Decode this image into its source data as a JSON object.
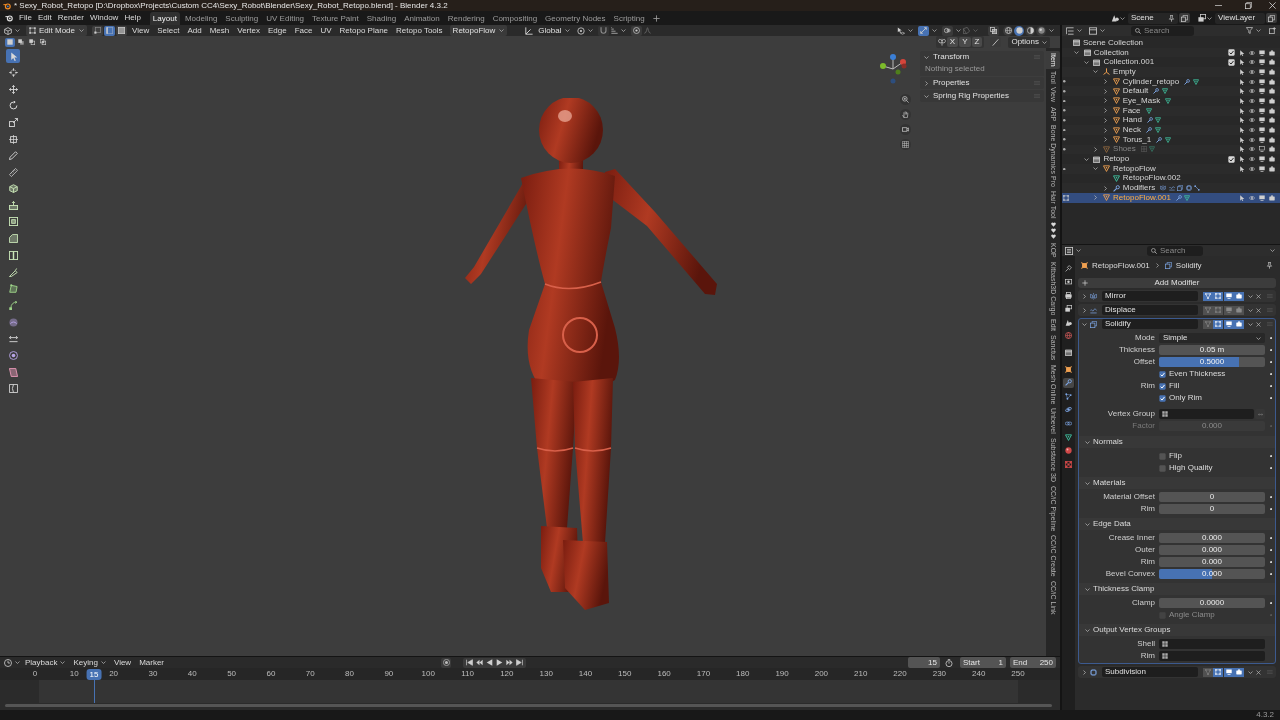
{
  "window": {
    "title": "* Sexy_Robot_Retopo [D:\\Dropbox\\Projects\\Custom CC4\\Sexy_Robot\\Blender\\Sexy_Robot_Retopo.blend] - Blender 4.3.2"
  },
  "menu": [
    "File",
    "Edit",
    "Render",
    "Window",
    "Help"
  ],
  "workspaces": [
    {
      "label": "Layout",
      "selected": true
    },
    {
      "label": "Modeling",
      "selected": false
    },
    {
      "label": "Sculpting",
      "selected": false
    },
    {
      "label": "UV Editing",
      "selected": false
    },
    {
      "label": "Texture Paint",
      "selected": false
    },
    {
      "label": "Shading",
      "selected": false
    },
    {
      "label": "Animation",
      "selected": false
    },
    {
      "label": "Rendering",
      "selected": false
    },
    {
      "label": "Compositing",
      "selected": false
    },
    {
      "label": "Geometry Nodes",
      "selected": false
    },
    {
      "label": "Scripting",
      "selected": false
    }
  ],
  "scene": {
    "name": "Scene",
    "view_layer": "ViewLayer"
  },
  "viewport": {
    "mode": "Edit Mode",
    "select_modes": [
      {
        "kind": "vertex",
        "selected": false
      },
      {
        "kind": "edge",
        "selected": true
      },
      {
        "kind": "face",
        "selected": false
      }
    ],
    "menus": [
      "View",
      "Select",
      "Add",
      "Mesh",
      "Vertex",
      "Edge",
      "Face",
      "UV",
      "Retopo Plane",
      "Retopo Tools"
    ],
    "addon_menu": "RetopoFlow",
    "orientation": "Global",
    "gizmos": true,
    "overlays": false,
    "xray": false,
    "shading": [
      {
        "kind": "wireframe",
        "selected": false
      },
      {
        "kind": "solid",
        "selected": true
      },
      {
        "kind": "material",
        "selected": false
      },
      {
        "kind": "rendered",
        "selected": false
      }
    ],
    "box_modes": [
      {
        "kind": "set",
        "selected": true
      },
      {
        "kind": "extend",
        "selected": false
      },
      {
        "kind": "subtract",
        "selected": false
      },
      {
        "kind": "intersect",
        "selected": false
      }
    ],
    "mirror_axes": [
      {
        "label": "X",
        "selected": false
      },
      {
        "label": "Y",
        "selected": false
      },
      {
        "label": "Z",
        "selected": false
      }
    ],
    "options": "Options",
    "tool_groups": [
      {
        "tools": [
          {
            "kind": "select",
            "selected": true
          }
        ]
      },
      {
        "tools": [
          {
            "kind": "cursor",
            "selected": false
          }
        ]
      },
      {
        "tools": [
          {
            "kind": "move",
            "selected": false
          },
          {
            "kind": "rotate",
            "selected": false
          },
          {
            "kind": "scale",
            "selected": false
          },
          {
            "kind": "transform",
            "selected": false
          }
        ]
      },
      {
        "tools": [
          {
            "kind": "annotate",
            "selected": false
          },
          {
            "kind": "measure",
            "selected": false
          }
        ]
      },
      {
        "tools": [
          {
            "kind": "add_cube",
            "selected": false
          }
        ]
      },
      {
        "tools": [
          {
            "kind": "extrude",
            "selected": false
          },
          {
            "kind": "inset",
            "selected": false
          },
          {
            "kind": "bevel",
            "selected": false
          },
          {
            "kind": "loop_cut",
            "selected": false
          },
          {
            "kind": "knife",
            "selected": false
          },
          {
            "kind": "poly_build",
            "selected": false
          },
          {
            "kind": "spin",
            "selected": false
          },
          {
            "kind": "smooth",
            "selected": false
          },
          {
            "kind": "edge_slide",
            "selected": false
          },
          {
            "kind": "shrink",
            "selected": false
          },
          {
            "kind": "shear",
            "selected": false
          },
          {
            "kind": "rip",
            "selected": false
          }
        ]
      }
    ],
    "sidebar": {
      "panels": [
        {
          "title": "Transform",
          "expanded": true,
          "text": "Nothing selected"
        },
        {
          "title": "Properties",
          "expanded": false
        },
        {
          "title": "Spring Rig Properties",
          "expanded": true
        }
      ],
      "tabs": [
        {
          "kind": "text",
          "label": "Item",
          "selected": true
        },
        {
          "kind": "text",
          "label": "Tool",
          "selected": false
        },
        {
          "kind": "text",
          "label": "View",
          "selected": false
        },
        {
          "kind": "text",
          "label": "ARP",
          "selected": false
        },
        {
          "kind": "text",
          "label": "Bone Dynamics Pro",
          "selected": false
        },
        {
          "kind": "text",
          "label": "Hair Tool",
          "selected": false
        },
        {
          "kind": "hearts",
          "selected": false
        },
        {
          "kind": "text",
          "label": "KOP",
          "selected": false
        },
        {
          "kind": "text",
          "label": "Kitbash3D Cargo",
          "selected": false
        },
        {
          "kind": "text",
          "label": "Edit",
          "selected": false
        },
        {
          "kind": "text",
          "label": "Sanctus",
          "selected": false
        },
        {
          "kind": "text",
          "label": "Mesh Online",
          "selected": false
        },
        {
          "kind": "text",
          "label": "Unbevel",
          "selected": false
        },
        {
          "kind": "text",
          "label": "Substance 3D",
          "selected": false
        },
        {
          "kind": "text",
          "label": "CC/iC Pipeline",
          "selected": false
        },
        {
          "kind": "text",
          "label": "CC/iC Create",
          "selected": false
        },
        {
          "kind": "text",
          "label": "CC/iC Link",
          "selected": false
        }
      ]
    }
  },
  "outliner": {
    "search_placeholder": "Search",
    "tree": [
      {
        "name": "Scene Collection",
        "kind": "scene_collection",
        "selected": false,
        "children": [
          {
            "name": "Collection",
            "kind": "collection",
            "expanded": true,
            "checked": true,
            "selected": false,
            "children": [
              {
                "name": "Collection.001",
                "kind": "collection",
                "expanded": true,
                "checked": true,
                "selected": false,
                "children": [
                  {
                    "name": "Empty",
                    "kind": "empty",
                    "expanded": true,
                    "hidden": false,
                    "selected": false,
                    "children": [
                      {
                        "name": "Cylinder_retopo",
                        "kind": "mesh_object",
                        "expanded": false,
                        "hidden": false,
                        "in_edit_mode": false,
                        "selected": false,
                        "contents": [
                          {
                            "kind": "modifier"
                          },
                          {
                            "kind": "mesh"
                          }
                        ]
                      },
                      {
                        "name": "Default",
                        "kind": "mesh_object",
                        "expanded": false,
                        "hidden": false,
                        "in_edit_mode": false,
                        "selected": false,
                        "contents": [
                          {
                            "kind": "modifier"
                          },
                          {
                            "kind": "mesh"
                          }
                        ]
                      },
                      {
                        "name": "Eye_Mask",
                        "kind": "mesh_object",
                        "expanded": false,
                        "hidden": false,
                        "in_edit_mode": false,
                        "selected": false,
                        "contents": [
                          {
                            "kind": "mesh"
                          }
                        ]
                      },
                      {
                        "name": "Face",
                        "kind": "mesh_object",
                        "expanded": false,
                        "hidden": false,
                        "in_edit_mode": false,
                        "selected": false,
                        "contents": [
                          {
                            "kind": "mesh"
                          }
                        ]
                      },
                      {
                        "name": "Hand",
                        "kind": "mesh_object",
                        "expanded": false,
                        "hidden": false,
                        "in_edit_mode": false,
                        "selected": false,
                        "contents": [
                          {
                            "kind": "modifier"
                          },
                          {
                            "kind": "mesh"
                          }
                        ]
                      },
                      {
                        "name": "Neck",
                        "kind": "mesh_object",
                        "expanded": false,
                        "hidden": false,
                        "in_edit_mode": false,
                        "selected": false,
                        "contents": [
                          {
                            "kind": "modifier"
                          },
                          {
                            "kind": "mesh"
                          }
                        ]
                      },
                      {
                        "name": "Torus_1",
                        "kind": "mesh_object",
                        "expanded": false,
                        "hidden": false,
                        "in_edit_mode": false,
                        "selected": false,
                        "contents": [
                          {
                            "kind": "modifier"
                          },
                          {
                            "kind": "mesh"
                          }
                        ]
                      }
                    ]
                  },
                  {
                    "name": "Shoes",
                    "kind": "mesh_object",
                    "expanded": false,
                    "hidden": true,
                    "in_edit_mode": false,
                    "selected": false,
                    "contents": [
                      {
                        "kind": "lattice"
                      },
                      {
                        "kind": "mesh"
                      }
                    ]
                  }
                ]
              },
              {
                "name": "Retopo",
                "kind": "collection",
                "expanded": true,
                "checked": true,
                "selected": false,
                "children": [
                  {
                    "name": "RetopoFlow",
                    "kind": "mesh_object",
                    "expanded": true,
                    "hidden": false,
                    "in_edit_mode": false,
                    "selected": false,
                    "children": [
                      {
                        "name": "RetopoFlow.002",
                        "kind": "mesh_data",
                        "selected": false
                      },
                      {
                        "name": "Modifiers",
                        "kind": "modifiers",
                        "expanded": false,
                        "selected": false,
                        "contents": [
                          {
                            "kind": "mirror"
                          },
                          {
                            "kind": "displace"
                          },
                          {
                            "kind": "solidify"
                          },
                          {
                            "kind": "subdivision"
                          },
                          {
                            "kind": "weld"
                          }
                        ]
                      }
                    ]
                  },
                  {
                    "name": "RetopoFlow.001",
                    "kind": "mesh_object",
                    "expanded": false,
                    "hidden": false,
                    "in_edit_mode": true,
                    "selected": true,
                    "contents": [
                      {
                        "kind": "modifier"
                      },
                      {
                        "kind": "mesh"
                      }
                    ]
                  }
                ]
              }
            ]
          }
        ]
      }
    ]
  },
  "properties": {
    "search_placeholder": "Search",
    "tabs": [
      {
        "kind": "tool",
        "selected": false
      },
      {
        "kind": "render",
        "selected": false
      },
      {
        "kind": "output",
        "selected": false
      },
      {
        "kind": "view_layer",
        "selected": false
      },
      {
        "kind": "scene",
        "selected": false
      },
      {
        "kind": "world",
        "selected": false
      },
      {
        "kind": "collection",
        "selected": false
      },
      {
        "kind": "object",
        "selected": false
      },
      {
        "kind": "modifiers",
        "selected": true
      },
      {
        "kind": "particles",
        "selected": false
      },
      {
        "kind": "physics",
        "selected": false
      },
      {
        "kind": "constraints",
        "selected": false
      },
      {
        "kind": "data",
        "selected": false
      },
      {
        "kind": "material",
        "selected": false
      },
      {
        "kind": "texture",
        "selected": false
      }
    ],
    "breadcrumb": [
      {
        "kind": "object",
        "label": "RetopoFlow.001"
      },
      {
        "kind": "solidify",
        "label": "Solidify"
      }
    ],
    "add_modifier": "Add Modifier",
    "modifiers": [
      {
        "name": "Mirror",
        "kind": "mirror",
        "expanded": false,
        "selected": false,
        "on_cage": true,
        "edit_mode": true,
        "viewport": true,
        "render": true
      },
      {
        "name": "Displace",
        "kind": "displace",
        "expanded": false,
        "selected": false,
        "on_cage": false,
        "edit_mode": false,
        "viewport": false,
        "render": false
      },
      {
        "name": "Solidify",
        "kind": "solidify",
        "expanded": true,
        "selected": true,
        "on_cage": false,
        "edit_mode": true,
        "viewport": true,
        "render": true,
        "settings": [
          {
            "kind": "dropdown",
            "label": "Mode",
            "value": "Simple",
            "disabled": false
          },
          {
            "kind": "number",
            "label": "Thickness",
            "value": "0.05 m",
            "disabled": false
          },
          {
            "kind": "slider",
            "label": "Offset",
            "value": "0.5000",
            "level": 0.75,
            "disabled": false
          },
          {
            "kind": "checkbox",
            "text": "Even Thickness",
            "checked": true,
            "disabled": false
          },
          {
            "kind": "checkbox",
            "label": "Rim",
            "text": "Fill",
            "checked": true,
            "disabled": false
          },
          {
            "kind": "checkbox",
            "text": "Only Rim",
            "checked": true,
            "disabled": false
          },
          {
            "kind": "vertex_group",
            "label": "Vertex Group",
            "invert": true,
            "disabled": false
          },
          {
            "kind": "number",
            "label": "Factor",
            "value": "0.000",
            "disabled": true
          }
        ],
        "subpanels": [
          {
            "title": "Normals",
            "expanded": true,
            "rows": [
              {
                "kind": "checkbox",
                "text": "Flip",
                "checked": false,
                "disabled": false
              },
              {
                "kind": "checkbox",
                "text": "High Quality",
                "checked": false,
                "disabled": false
              }
            ]
          },
          {
            "title": "Materials",
            "expanded": true,
            "rows": [
              {
                "kind": "number",
                "label": "Material Offset",
                "value": "0",
                "disabled": false
              },
              {
                "kind": "number",
                "label": "Rim",
                "value": "0",
                "disabled": false
              }
            ]
          },
          {
            "title": "Edge Data",
            "expanded": true,
            "rows": [
              {
                "kind": "number",
                "label": "Crease Inner",
                "value": "0.000",
                "disabled": false
              },
              {
                "kind": "number",
                "label": "Outer",
                "value": "0.000",
                "disabled": false
              },
              {
                "kind": "number",
                "label": "Rim",
                "value": "0.000",
                "disabled": false
              },
              {
                "kind": "slider",
                "label": "Bevel Convex",
                "value": "0.000",
                "level": 0.5,
                "disabled": false
              }
            ]
          },
          {
            "title": "Thickness Clamp",
            "expanded": true,
            "rows": [
              {
                "kind": "number",
                "label": "Clamp",
                "value": "0.0000",
                "disabled": false
              },
              {
                "kind": "checkbox",
                "text": "Angle Clamp",
                "checked": false,
                "disabled": true
              }
            ]
          },
          {
            "title": "Output Vertex Groups",
            "expanded": true,
            "rows": [
              {
                "kind": "vertex_group",
                "label": "Shell",
                "invert": false,
                "disabled": false
              },
              {
                "kind": "vertex_group",
                "label": "Rim",
                "invert": false,
                "disabled": false
              }
            ]
          }
        ]
      },
      {
        "name": "Subdivision",
        "kind": "subdivision",
        "expanded": false,
        "selected": false,
        "on_cage": false,
        "edit_mode": true,
        "viewport": true,
        "render": true
      }
    ]
  },
  "timeline": {
    "menus": [
      {
        "label": "Playback",
        "dropdown": true
      },
      {
        "label": "Keying",
        "dropdown": true
      },
      {
        "label": "View",
        "dropdown": false
      },
      {
        "label": "Marker",
        "dropdown": false
      }
    ],
    "auto_keying": false,
    "current_frame": "15",
    "start_label": "Start",
    "start": "1",
    "end_label": "End",
    "end": "250",
    "ruler": [
      "0",
      "10",
      "20",
      "30",
      "40",
      "50",
      "60",
      "70",
      "80",
      "90",
      "100",
      "110",
      "120",
      "130",
      "140",
      "150",
      "160",
      "170",
      "180",
      "190",
      "200",
      "210",
      "220",
      "230",
      "240",
      "250"
    ],
    "playhead": {
      "label": "15",
      "level": 0.06
    }
  },
  "status_bar": {
    "version": "4.3.2"
  }
}
